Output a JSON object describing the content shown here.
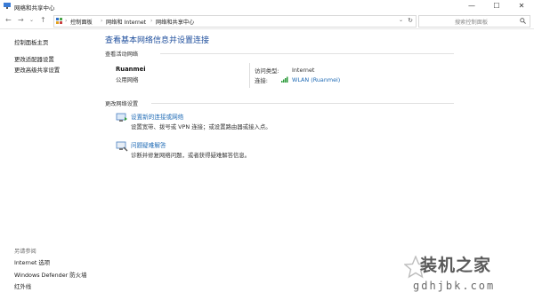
{
  "window": {
    "title": "网络和共享中心",
    "minimize": "—",
    "maximize": "☐",
    "close": "✕"
  },
  "nav": {
    "back": "←",
    "forward": "→",
    "down": "⌄",
    "up": "↑"
  },
  "address": {
    "crumbs": [
      "控制面板",
      "网络和 Internet",
      "网络和共享中心"
    ],
    "separator": "›",
    "dropdown": "⌄",
    "refresh": "↻"
  },
  "search": {
    "placeholder": "搜索控制面板"
  },
  "sidebar": {
    "items": [
      "控制面板主页",
      "更改适配器设置",
      "更改高级共享设置"
    ],
    "see_also_heading": "另请参阅",
    "see_also": [
      "Internet 选项",
      "Windows Defender 防火墙",
      "红外线"
    ]
  },
  "main": {
    "title": "查看基本网络信息并设置连接",
    "active_heading": "查看活动网络",
    "network": {
      "name": "Ruanmei",
      "type": "公用网络"
    },
    "access_label": "访问类型:",
    "access_value": "Internet",
    "conn_label": "连接:",
    "conn_value": "WLAN (Ruanmei)",
    "change_heading": "更改网络设置",
    "tasks": [
      {
        "title": "设置新的连接或网络",
        "desc": "设置宽带、拨号或 VPN 连接；或设置路由器或接入点。"
      },
      {
        "title": "问题疑难解答",
        "desc": "诊断并修复网络问题，或者获得疑难解答信息。"
      }
    ]
  },
  "watermark": {
    "text": "装机之家",
    "url": "gdhjbk.com"
  }
}
